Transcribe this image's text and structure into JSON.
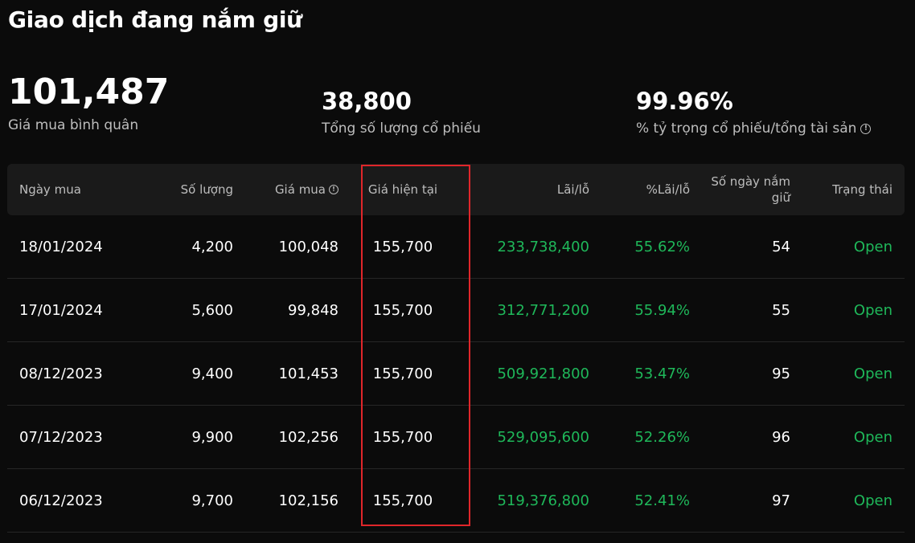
{
  "page": {
    "title": "Giao dịch đang nắm giữ"
  },
  "stats": {
    "avg_price": {
      "value": "101,487",
      "label": "Giá mua bình quân"
    },
    "total_qty": {
      "value": "38,800",
      "label": "Tổng số lượng cổ phiếu"
    },
    "ratio": {
      "value": "99.96%",
      "label": "% tỷ trọng cổ phiếu/tổng tài sản",
      "info_icon": "info-icon"
    }
  },
  "table": {
    "headers": {
      "date": "Ngày mua",
      "qty": "Số lượng",
      "buy_price": "Giá mua",
      "current_price": "Giá hiện tại",
      "pnl": "Lãi/lỗ",
      "pnl_pct": "%Lãi/lỗ",
      "days_line1": "Số ngày nắm",
      "days_line2": "giữ",
      "status": "Trạng thái"
    },
    "rows": [
      {
        "date": "18/01/2024",
        "qty": "4,200",
        "buy_price": "100,048",
        "current_price": "155,700",
        "pnl": "233,738,400",
        "pnl_pct": "55.62%",
        "days": "54",
        "status": "Open"
      },
      {
        "date": "17/01/2024",
        "qty": "5,600",
        "buy_price": "99,848",
        "current_price": "155,700",
        "pnl": "312,771,200",
        "pnl_pct": "55.94%",
        "days": "55",
        "status": "Open"
      },
      {
        "date": "08/12/2023",
        "qty": "9,400",
        "buy_price": "101,453",
        "current_price": "155,700",
        "pnl": "509,921,800",
        "pnl_pct": "53.47%",
        "days": "95",
        "status": "Open"
      },
      {
        "date": "07/12/2023",
        "qty": "9,900",
        "buy_price": "102,256",
        "current_price": "155,700",
        "pnl": "529,095,600",
        "pnl_pct": "52.26%",
        "days": "96",
        "status": "Open"
      },
      {
        "date": "06/12/2023",
        "qty": "9,700",
        "buy_price": "102,156",
        "current_price": "155,700",
        "pnl": "519,376,800",
        "pnl_pct": "52.41%",
        "days": "97",
        "status": "Open"
      }
    ]
  },
  "colors": {
    "positive": "#1fb85a",
    "highlight": "#e0262a",
    "background": "#0b0b0b",
    "header_bg": "#1a1a1a"
  }
}
